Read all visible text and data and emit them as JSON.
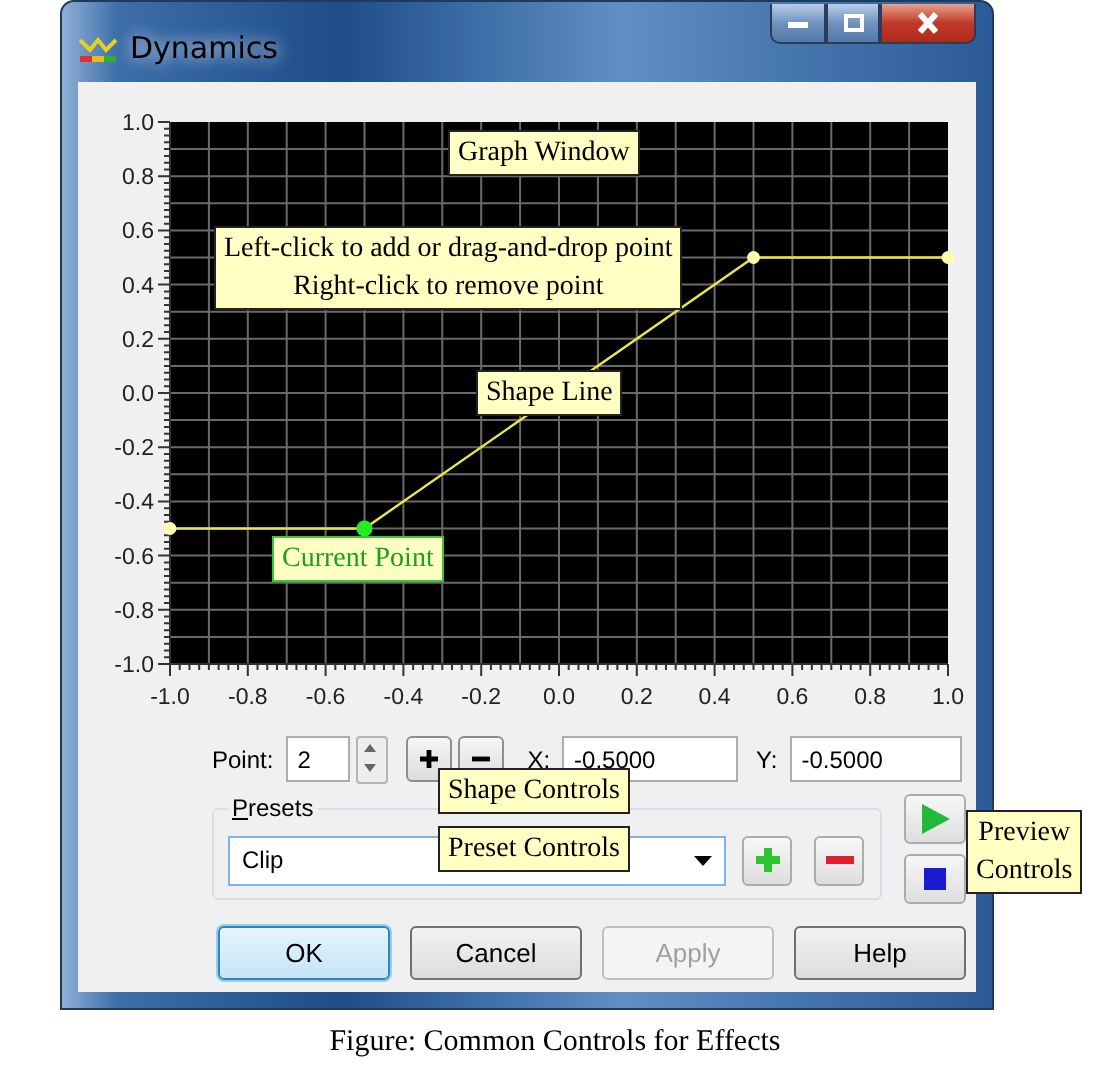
{
  "window": {
    "title": "Dynamics"
  },
  "graph": {
    "chart_data": {
      "type": "line",
      "x": [
        -1,
        -0.5,
        0.5,
        1
      ],
      "series": [
        {
          "color": "#e8e84a",
          "marker": "circle",
          "values": [
            -0.5,
            -0.5,
            0.5,
            0.5
          ]
        }
      ],
      "grid": true,
      "xlim": [
        -1,
        1
      ],
      "ylim": [
        -1,
        1
      ],
      "xticks": [
        {
          "value": -1,
          "label": "-1.0"
        },
        {
          "value": -0.8,
          "label": "-0.8"
        },
        {
          "value": -0.6,
          "label": "-0.6"
        },
        {
          "value": -0.4,
          "label": "-0.4"
        },
        {
          "value": -0.2,
          "label": "-0.2"
        },
        {
          "value": 0,
          "label": "0.0"
        },
        {
          "value": 0.2,
          "label": "0.2"
        },
        {
          "value": 0.4,
          "label": "0.4"
        },
        {
          "value": 0.6,
          "label": "0.6"
        },
        {
          "value": 0.8,
          "label": "0.8"
        },
        {
          "value": 1,
          "label": "1.0"
        }
      ],
      "yticks": [
        {
          "value": 1,
          "label": "1.0"
        },
        {
          "value": 0.8,
          "label": "0.8"
        },
        {
          "value": 0.6,
          "label": "0.6"
        },
        {
          "value": 0.4,
          "label": "0.4"
        },
        {
          "value": 0.2,
          "label": "0.2"
        },
        {
          "value": 0,
          "label": "0.0"
        },
        {
          "value": -0.2,
          "label": "-0.2"
        },
        {
          "value": -0.4,
          "label": "-0.4"
        },
        {
          "value": -0.6,
          "label": "-0.6"
        },
        {
          "value": -0.8,
          "label": "-0.8"
        },
        {
          "value": -1,
          "label": "-1.0"
        }
      ]
    },
    "points": [
      {
        "selected": false
      },
      {
        "selected": true
      },
      {
        "selected": false
      },
      {
        "selected": false
      }
    ]
  },
  "shape_controls": {
    "point_label": "Point:",
    "point_value": "2",
    "x_label": "X:",
    "x_value": "-0.5000",
    "y_label": "Y:",
    "y_value": "-0.5000"
  },
  "presets": {
    "label": "Presets",
    "value": "Clip"
  },
  "buttons": [
    {
      "label": "OK",
      "default": true,
      "disabled": false
    },
    {
      "label": "Cancel",
      "default": false,
      "disabled": false
    },
    {
      "label": "Apply",
      "default": false,
      "disabled": true
    },
    {
      "label": "Help",
      "default": false,
      "disabled": false
    }
  ],
  "callouts": [
    {
      "kind": "note",
      "lines": [
        "Graph Window"
      ]
    },
    {
      "kind": "note",
      "lines": [
        "Left-click to add or drag-and-drop point",
        "Right-click to remove point"
      ]
    },
    {
      "kind": "note",
      "lines": [
        "Shape Line"
      ]
    },
    {
      "kind": "highlight",
      "lines": [
        "Current Point"
      ]
    },
    {
      "kind": "note",
      "lines": [
        "Shape Controls"
      ]
    },
    {
      "kind": "note",
      "lines": [
        "Preset Controls"
      ]
    },
    {
      "kind": "note",
      "lines": [
        "Preview",
        "Controls"
      ]
    }
  ],
  "caption": "Figure: Common Controls for Effects"
}
